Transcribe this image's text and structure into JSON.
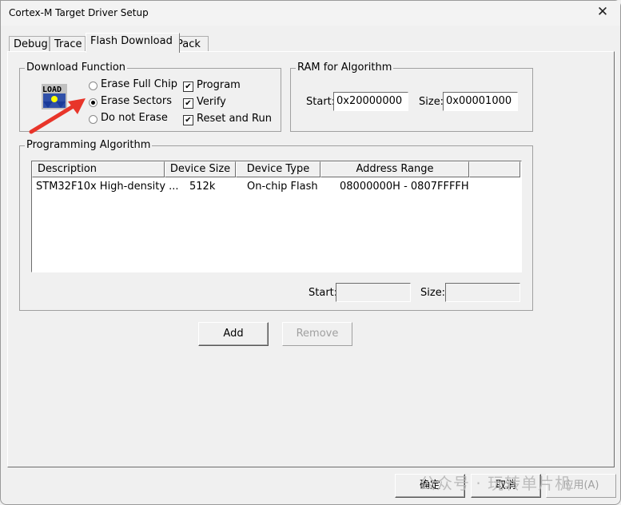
{
  "window": {
    "title": "Cortex-M Target Driver Setup",
    "close_icon": "close-icon"
  },
  "tabs": [
    {
      "label": "Debug",
      "active": false
    },
    {
      "label": "Trace",
      "active": false
    },
    {
      "label": "Flash Download",
      "active": true
    },
    {
      "label": "Pack",
      "active": false
    }
  ],
  "download_function": {
    "label": "Download Function",
    "icon": "load-icon",
    "radios": [
      {
        "label": "Erase Full Chip",
        "selected": false
      },
      {
        "label": "Erase Sectors",
        "selected": true
      },
      {
        "label": "Do not Erase",
        "selected": false
      }
    ],
    "checkboxes": [
      {
        "label": "Program",
        "checked": true
      },
      {
        "label": "Verify",
        "checked": true
      },
      {
        "label": "Reset and Run",
        "checked": true
      }
    ]
  },
  "ram_for_algorithm": {
    "label": "RAM for Algorithm",
    "start_label": "Start:",
    "start_value": "0x20000000",
    "size_label": "Size:",
    "size_value": "0x00001000"
  },
  "programming_algorithm": {
    "label": "Programming Algorithm",
    "columns": [
      "Description",
      "Device Size",
      "Device Type",
      "Address Range",
      ""
    ],
    "rows": [
      {
        "description": "STM32F10x High-density ...",
        "device_size": "512k",
        "device_type": "On-chip Flash",
        "address_range": "08000000H - 0807FFFFH"
      }
    ],
    "start_label": "Start:",
    "start_value": "",
    "size_label": "Size:",
    "size_value": ""
  },
  "buttons": {
    "add": "Add",
    "remove": "Remove"
  },
  "footer": {
    "ok": "确定",
    "cancel": "取消",
    "apply": "应用(A)"
  },
  "watermark": "公众号 · 玩转单片机",
  "annotation": {
    "arrow_color": "#e8352a"
  }
}
